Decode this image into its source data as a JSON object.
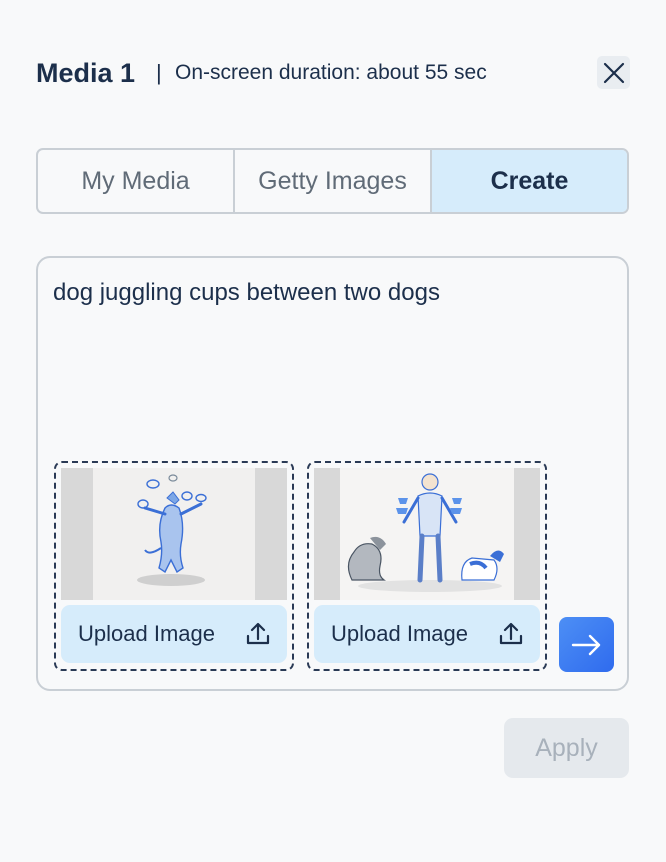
{
  "header": {
    "title": "Media 1",
    "separator": "|",
    "duration": "On-screen duration: about 55 sec",
    "close_icon": "close-icon"
  },
  "tabs": [
    {
      "label": "My Media",
      "active": false
    },
    {
      "label": "Getty Images",
      "active": false
    },
    {
      "label": "Create",
      "active": true
    }
  ],
  "prompt": {
    "value": "dog juggling cups between two dogs"
  },
  "cards": [
    {
      "upload_label": "Upload Image",
      "icon": "upload-icon"
    },
    {
      "upload_label": "Upload Image",
      "icon": "upload-icon"
    }
  ],
  "submit_icon": "arrow-right-icon",
  "apply_label": "Apply",
  "colors": {
    "accent": "#3b7cf2",
    "active_tab_bg": "#d6ecfb",
    "text": "#1c2f4b",
    "disabled": "#a8b1bb"
  }
}
